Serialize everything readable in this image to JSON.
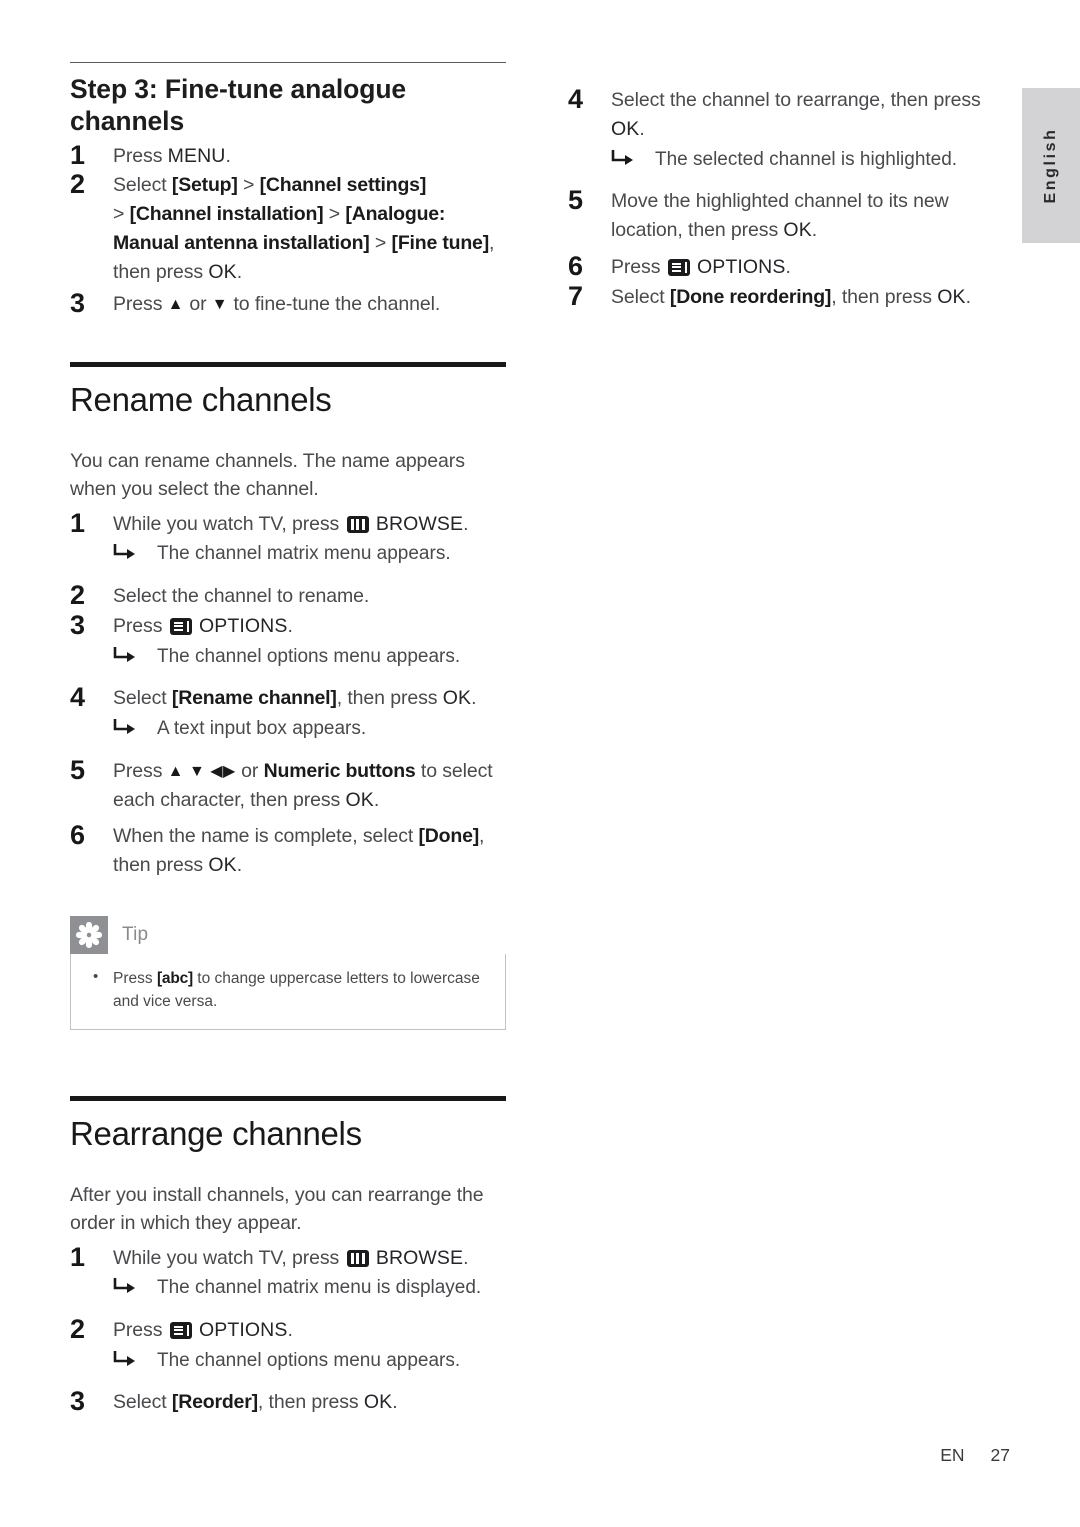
{
  "language_tab": {
    "label": "English"
  },
  "footer": {
    "locale": "EN",
    "page_number": "27"
  },
  "left_column": {
    "step_section": {
      "heading": "Step 3: Fine-tune analogue channels",
      "steps": [
        {
          "num": "1",
          "text_a": "Press ",
          "text_b": "MENU",
          "text_c": "."
        },
        {
          "num": "2",
          "line1_a": "Select ",
          "line1_b": "[Setup]",
          "line1_c": " > ",
          "line1_d": "[Channel settings]",
          "line2_a": "> ",
          "line2_b": "[Channel installation]",
          "line2_c": " > ",
          "line2_d": "[Analogue:",
          "line3_a": "Manual antenna installation]",
          "line3_b": " > ",
          "line3_c": "[Fine tune]",
          "line3_d": ",",
          "line4_a": "then press ",
          "line4_b": "OK",
          "line4_c": "."
        },
        {
          "num": "3",
          "text_a": "Press ",
          "arrow_up": "▲",
          "text_b": " or ",
          "arrow_down": "▼",
          "text_c": " to fine-tune the channel."
        }
      ]
    },
    "rename_section": {
      "heading": "Rename channels",
      "intro": "You can rename channels. The name appears when you select the channel.",
      "steps": [
        {
          "num": "1",
          "text_a": "While you watch TV, press ",
          "icon": "browse-icon",
          "text_b": "BROWSE",
          "text_c": ".",
          "result": "The channel matrix menu appears."
        },
        {
          "num": "2",
          "text_a": "Select the channel to rename."
        },
        {
          "num": "3",
          "text_a": "Press ",
          "icon": "options-icon",
          "text_b": "OPTIONS",
          "text_c": ".",
          "result": "The channel options menu appears."
        },
        {
          "num": "4",
          "text_a": "Select ",
          "text_b": "[Rename channel]",
          "text_c": ", then press ",
          "text_d": "OK",
          "text_e": ".",
          "result": "A text input box appears."
        },
        {
          "num": "5",
          "text_a": "Press ",
          "arrows": "▲ ▼ ◀▶",
          "text_b": " or ",
          "text_c": "Numeric buttons",
          "text_d": " to select each character, then press ",
          "text_e": "OK",
          "text_f": "."
        },
        {
          "num": "6",
          "text_a": "When the name is complete, select ",
          "text_b": "[Done]",
          "text_c": ", then press ",
          "text_d": "OK",
          "text_e": "."
        }
      ],
      "tip": {
        "label": "Tip",
        "icon": "asterisk-icon",
        "items": [
          {
            "text_a": "Press ",
            "text_b": "[abc]",
            "text_c": " to change uppercase letters to lowercase and vice versa."
          }
        ]
      }
    },
    "rearrange_section": {
      "heading": "Rearrange channels",
      "intro": "After you install channels, you can rearrange the order in which they appear.",
      "steps": [
        {
          "num": "1",
          "text_a": "While you watch TV, press ",
          "icon": "browse-icon",
          "text_b": "BROWSE",
          "text_c": ".",
          "result": "The channel matrix menu is displayed."
        },
        {
          "num": "2",
          "text_a": "Press ",
          "icon": "options-icon",
          "text_b": "OPTIONS",
          "text_c": ".",
          "result": "The channel options menu appears."
        },
        {
          "num": "3",
          "text_a": "Select ",
          "text_b": "[Reorder]",
          "text_c": ", then press ",
          "text_d": "OK",
          "text_e": "."
        }
      ]
    }
  },
  "right_column": {
    "steps": [
      {
        "num": "4",
        "text_a": "Select the channel to rearrange, then press ",
        "text_b": "OK",
        "text_c": ".",
        "result": "The selected channel is highlighted."
      },
      {
        "num": "5",
        "text_a": "Move the highlighted channel to its new location, then press ",
        "text_b": "OK",
        "text_c": "."
      },
      {
        "num": "6",
        "text_a": "Press ",
        "icon": "options-icon",
        "text_b": "OPTIONS",
        "text_c": "."
      },
      {
        "num": "7",
        "text_a": "Select ",
        "text_b": "[Done reordering]",
        "text_c": ", then press ",
        "text_d": "OK",
        "text_e": "."
      }
    ]
  }
}
